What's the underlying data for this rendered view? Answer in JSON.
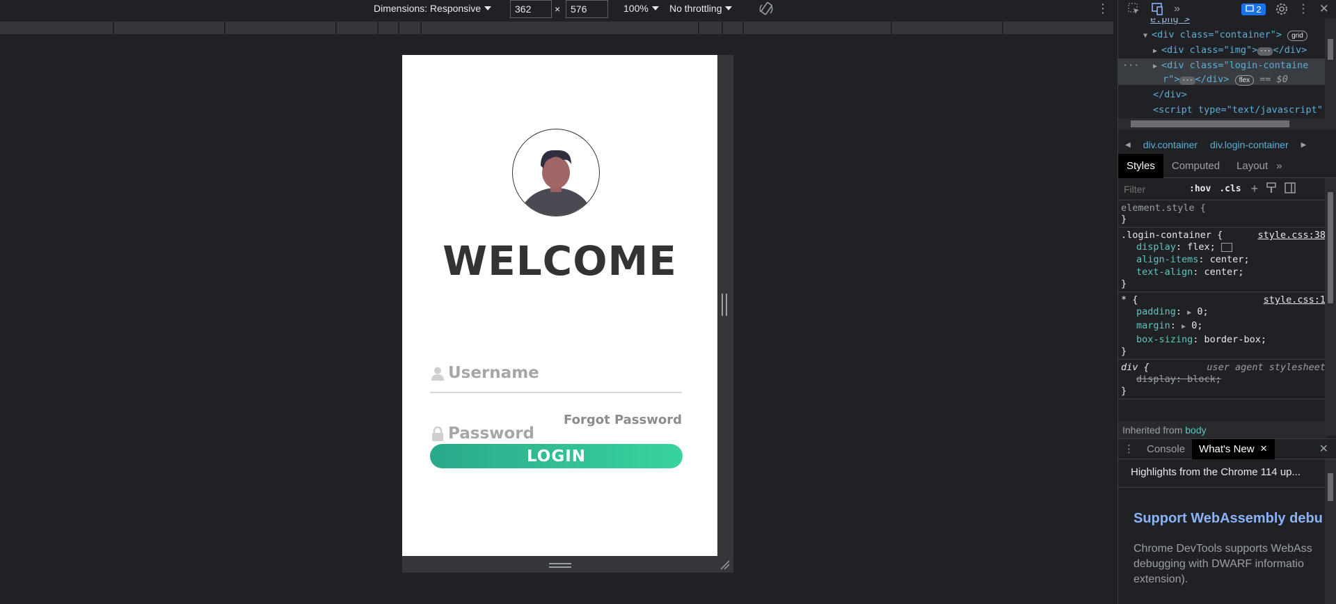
{
  "toolbar": {
    "dimensions_label": "Dimensions: Responsive",
    "width_value": "362",
    "times": "×",
    "height_value": "576",
    "zoom": "100%",
    "throttling": "No throttling"
  },
  "app": {
    "welcome": "WELCOME",
    "username_placeholder": "Username",
    "password_placeholder": "Password",
    "forgot": "Forgot Password",
    "login": "LOGIN",
    "colors": {
      "accent_start": "#2aa98a",
      "accent_end": "#38d39f"
    }
  },
  "devtools": {
    "issues_count": "2",
    "elements": {
      "line0": "e.png\">",
      "line1_tag": "<div class=\"container\">",
      "line1_pill": "grid",
      "line2_tag": "<div class=\"img\">",
      "line2_end": "</div>",
      "line3_tag": "<div class=\"login-containe",
      "line3b": "r\">",
      "line3_end": "</div>",
      "line3_pill": "flex",
      "line3_eq": "== $0",
      "line4": "</div>",
      "line5": "<script type=\"text/javascript\""
    },
    "breadcrumbs": [
      "div.container",
      "div.login-container"
    ],
    "tabs": [
      "Styles",
      "Computed",
      "Layout"
    ],
    "filter_placeholder": "Filter",
    "hov": ":hov",
    "cls": ".cls",
    "rules": {
      "element_style": "element.style {",
      "login_sel": ".login-container {",
      "login_src": "style.css:38",
      "login_decls": [
        {
          "p": "display",
          "v": "flex;"
        },
        {
          "p": "align-items",
          "v": "center;"
        },
        {
          "p": "text-align",
          "v": "center;"
        }
      ],
      "star_sel": "* {",
      "star_src": "style.css:1",
      "star_decls": [
        {
          "p": "padding",
          "v": "0;"
        },
        {
          "p": "margin",
          "v": "0;"
        },
        {
          "p": "box-sizing",
          "v": "border-box;"
        }
      ],
      "div_sel": "div {",
      "div_src": "user agent stylesheet",
      "div_decl": "display: block;",
      "close": "}"
    },
    "inherited_from": "Inherited from",
    "inherited_el": "body",
    "drawer_tabs": [
      "Console",
      "What's New"
    ],
    "highlights": "Highlights from the Chrome 114 up...",
    "feature_title": "Support WebAssembly debu",
    "feature_desc": "Chrome DevTools supports WebAss debugging with DWARF informatio extension)."
  }
}
